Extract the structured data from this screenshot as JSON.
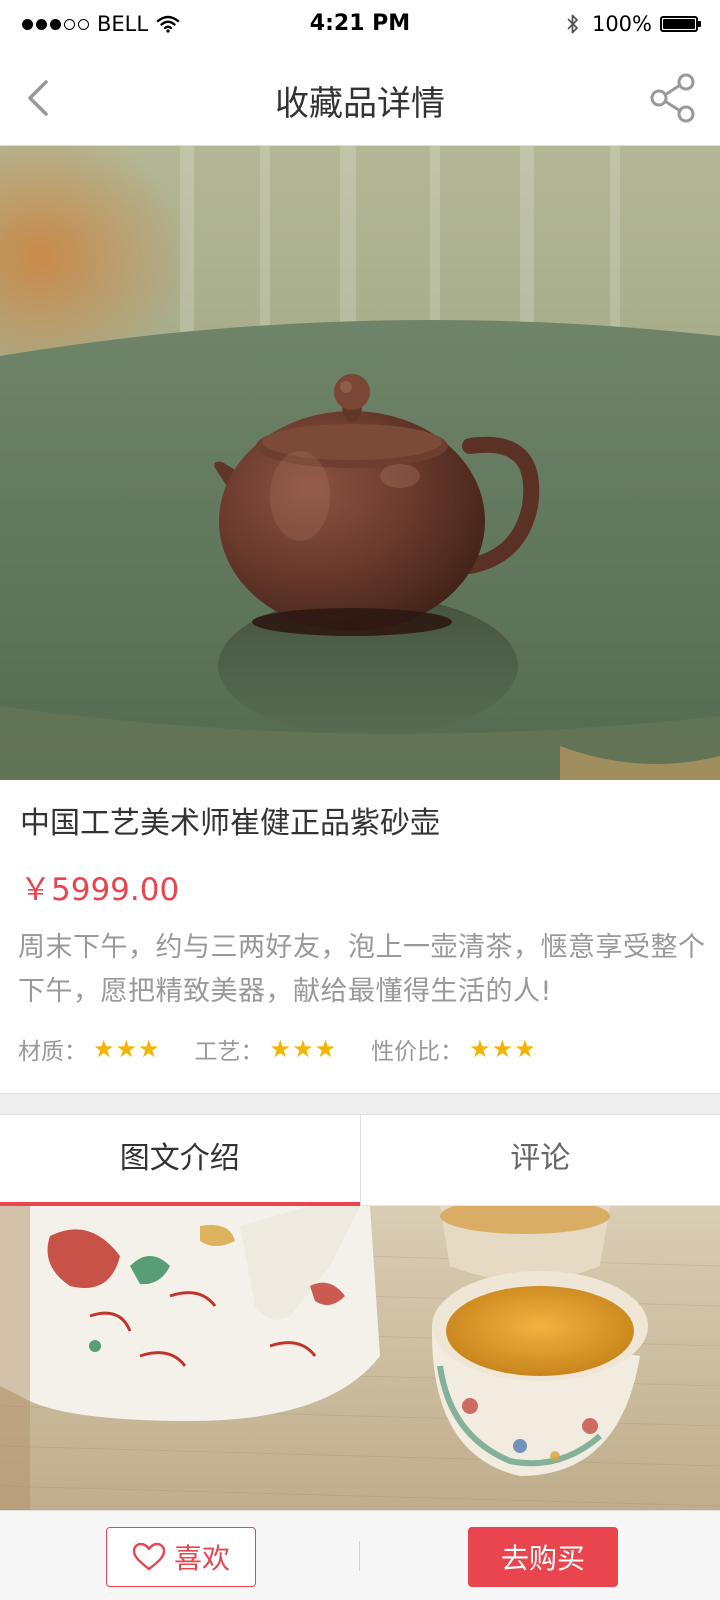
{
  "status_bar": {
    "carrier": "BELL",
    "time": "4:21 PM",
    "battery_percent": "100%",
    "signal_bars": 3,
    "signal_total": 5,
    "battery_level": 1.0
  },
  "nav": {
    "title": "收藏品详情",
    "back_icon": "chevron-left-icon",
    "share_icon": "share-icon"
  },
  "hero": {
    "subject": "purple clay teapot on green glazed tray"
  },
  "product": {
    "title": "中国工艺美术师崔健正品紫砂壶",
    "price": "￥5999.00",
    "description": "周末下午，约与三两好友，泡上一壶清茶，惬意享受整个下午，愿把精致美器，献给最懂得生活的人!",
    "ratings": [
      {
        "label": "材质：",
        "stars": 3
      },
      {
        "label": "工艺：",
        "stars": 3
      },
      {
        "label": "性价比：",
        "stars": 3
      }
    ]
  },
  "tabs": [
    {
      "label": "图文介绍",
      "active": true
    },
    {
      "label": "评论",
      "active": false
    }
  ],
  "bottom_bar": {
    "like_label": "喜欢",
    "buy_label": "去购买",
    "like_icon": "heart-icon"
  },
  "colors": {
    "accent": "#e8454f",
    "star": "#f5b400",
    "muted_text": "#999999"
  }
}
